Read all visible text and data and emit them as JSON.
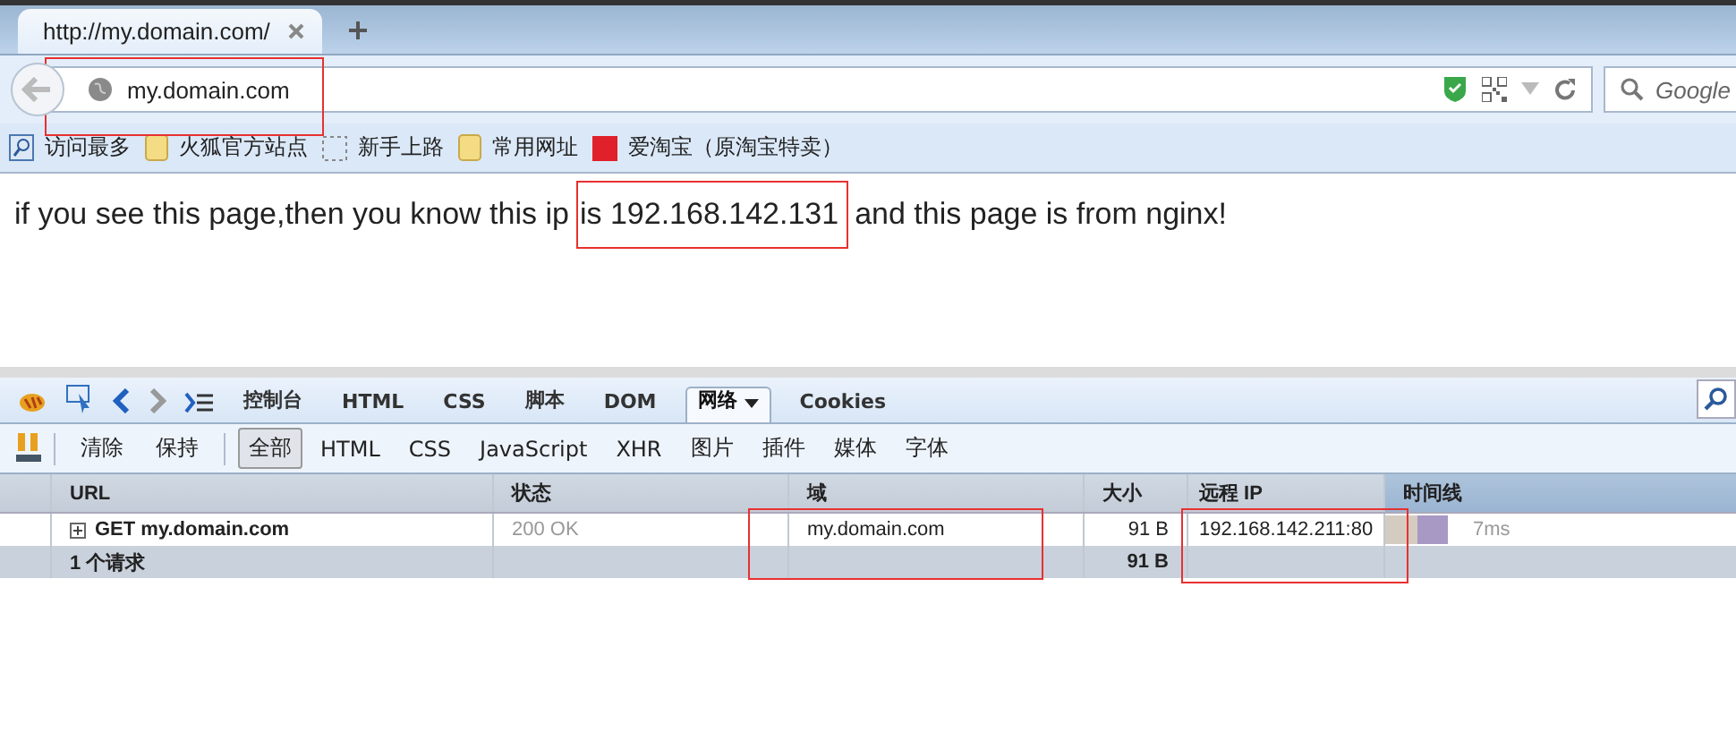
{
  "browser": {
    "tabs": [
      {
        "title": "http://my.domain.com/",
        "selected": true
      }
    ],
    "address": {
      "value": "my.domain.com"
    },
    "search": {
      "placeholder": "Google"
    },
    "bookmarks": [
      {
        "kind": "search",
        "label": "访问最多"
      },
      {
        "kind": "folder",
        "label": "火狐官方站点"
      },
      {
        "kind": "dashed",
        "label": "新手上路"
      },
      {
        "kind": "folder",
        "label": "常用网址"
      },
      {
        "kind": "taobao",
        "label": "爱淘宝（原淘宝特卖）"
      }
    ]
  },
  "page": {
    "parts": [
      {
        "kind": "plain",
        "text": "if you see this page,then you know this ip"
      },
      {
        "kind": "marked",
        "text": "is 192.168.142.131"
      },
      {
        "kind": "plain",
        "text": "and this page is from nginx!"
      }
    ]
  },
  "firebug": {
    "panels": [
      {
        "label": "控制台",
        "selected": false
      },
      {
        "label": "HTML",
        "selected": false
      },
      {
        "label": "CSS",
        "selected": false
      },
      {
        "label": "脚本",
        "selected": false
      },
      {
        "label": "DOM",
        "selected": false
      },
      {
        "label": "网络",
        "selected": true
      },
      {
        "label": "Cookies",
        "selected": false
      }
    ],
    "filters": [
      {
        "kind": "action",
        "label": "清除",
        "selected": false
      },
      {
        "kind": "action",
        "label": "保持",
        "selected": false
      },
      {
        "kind": "filter",
        "label": "全部",
        "selected": true
      },
      {
        "kind": "filter",
        "label": "HTML",
        "selected": false
      },
      {
        "kind": "filter",
        "label": "CSS",
        "selected": false
      },
      {
        "kind": "filter",
        "label": "JavaScript",
        "selected": false
      },
      {
        "kind": "filter",
        "label": "XHR",
        "selected": false
      },
      {
        "kind": "filter",
        "label": "图片",
        "selected": false
      },
      {
        "kind": "filter",
        "label": "插件",
        "selected": false
      },
      {
        "kind": "filter",
        "label": "媒体",
        "selected": false
      },
      {
        "kind": "filter",
        "label": "字体",
        "selected": false
      }
    ],
    "table": {
      "columns": [
        "URL",
        "状态",
        "域",
        "大小",
        "远程 IP",
        "时间线"
      ],
      "rows": [
        {
          "url": "GET my.domain.com",
          "status": "200 OK",
          "domain": "my.domain.com",
          "size": "91 B",
          "remote_ip": "192.168.142.211:80",
          "time": "7ms"
        }
      ],
      "summary": {
        "count": "1 个请求",
        "size": "91 B"
      }
    }
  }
}
